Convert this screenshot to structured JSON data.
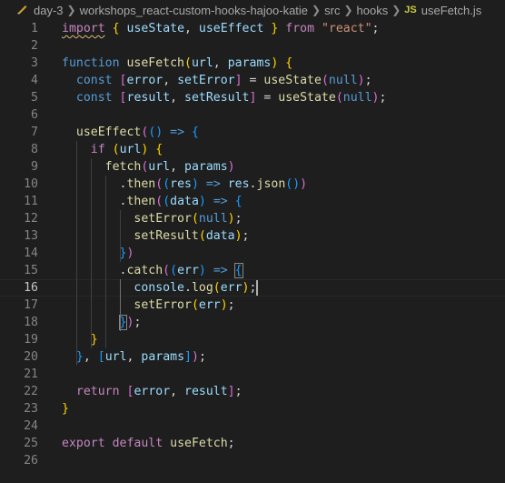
{
  "breadcrumb": {
    "items": [
      "day-3",
      "workshops_react-custom-hooks-hajoo-katie",
      "src",
      "hooks"
    ],
    "file_icon": "JS",
    "file": "useFetch.js"
  },
  "editor": {
    "lines": [
      {
        "n": "1",
        "t": [
          [
            "ctl squig",
            "import"
          ],
          [
            "pun",
            " "
          ],
          [
            "b1",
            "{"
          ],
          [
            "pun",
            " "
          ],
          [
            "var",
            "useState"
          ],
          [
            "pun",
            ", "
          ],
          [
            "var",
            "useEffect"
          ],
          [
            "pun",
            " "
          ],
          [
            "b1",
            "}"
          ],
          [
            "pun",
            " "
          ],
          [
            "ctl",
            "from"
          ],
          [
            "pun",
            " "
          ],
          [
            "str",
            "\"react\""
          ],
          [
            "pun",
            ";"
          ]
        ]
      },
      {
        "n": "2",
        "t": []
      },
      {
        "n": "3",
        "t": [
          [
            "kw",
            "function"
          ],
          [
            "pun",
            " "
          ],
          [
            "fn",
            "useFetch"
          ],
          [
            "b1",
            "("
          ],
          [
            "var",
            "url"
          ],
          [
            "pun",
            ", "
          ],
          [
            "var",
            "params"
          ],
          [
            "b1",
            ")"
          ],
          [
            "pun",
            " "
          ],
          [
            "b1",
            "{"
          ]
        ]
      },
      {
        "n": "4",
        "t": [
          [
            "pun",
            "  "
          ],
          [
            "kw",
            "const"
          ],
          [
            "pun",
            " "
          ],
          [
            "b2",
            "["
          ],
          [
            "var",
            "error"
          ],
          [
            "pun",
            ", "
          ],
          [
            "var",
            "setError"
          ],
          [
            "b2",
            "]"
          ],
          [
            "pun",
            " = "
          ],
          [
            "fn",
            "useState"
          ],
          [
            "b2",
            "("
          ],
          [
            "kw",
            "null"
          ],
          [
            "b2",
            ")"
          ],
          [
            "pun",
            ";"
          ]
        ]
      },
      {
        "n": "5",
        "t": [
          [
            "pun",
            "  "
          ],
          [
            "kw",
            "const"
          ],
          [
            "pun",
            " "
          ],
          [
            "b2",
            "["
          ],
          [
            "var",
            "result"
          ],
          [
            "pun",
            ", "
          ],
          [
            "var",
            "setResult"
          ],
          [
            "b2",
            "]"
          ],
          [
            "pun",
            " = "
          ],
          [
            "fn",
            "useState"
          ],
          [
            "b2",
            "("
          ],
          [
            "kw",
            "null"
          ],
          [
            "b2",
            ")"
          ],
          [
            "pun",
            ";"
          ]
        ]
      },
      {
        "n": "6",
        "t": []
      },
      {
        "n": "7",
        "t": [
          [
            "pun",
            "  "
          ],
          [
            "fn",
            "useEffect"
          ],
          [
            "b2",
            "("
          ],
          [
            "b3",
            "()"
          ],
          [
            "pun",
            " "
          ],
          [
            "kw",
            "=>"
          ],
          [
            "pun",
            " "
          ],
          [
            "b3",
            "{"
          ]
        ]
      },
      {
        "n": "8",
        "t": [
          [
            "pun",
            "    "
          ],
          [
            "ctl",
            "if"
          ],
          [
            "pun",
            " "
          ],
          [
            "b1",
            "("
          ],
          [
            "var",
            "url"
          ],
          [
            "b1",
            ")"
          ],
          [
            "pun",
            " "
          ],
          [
            "b1",
            "{"
          ]
        ]
      },
      {
        "n": "9",
        "t": [
          [
            "pun",
            "      "
          ],
          [
            "fn",
            "fetch"
          ],
          [
            "b2",
            "("
          ],
          [
            "var",
            "url"
          ],
          [
            "pun",
            ", "
          ],
          [
            "var",
            "params"
          ],
          [
            "b2",
            ")"
          ]
        ]
      },
      {
        "n": "10",
        "t": [
          [
            "pun",
            "        ."
          ],
          [
            "fn",
            "then"
          ],
          [
            "b2",
            "("
          ],
          [
            "b3",
            "("
          ],
          [
            "var",
            "res"
          ],
          [
            "b3",
            ")"
          ],
          [
            "pun",
            " "
          ],
          [
            "kw",
            "=>"
          ],
          [
            "pun",
            " "
          ],
          [
            "var",
            "res"
          ],
          [
            "pun",
            "."
          ],
          [
            "fn",
            "json"
          ],
          [
            "b3",
            "()"
          ],
          [
            "b2",
            ")"
          ]
        ]
      },
      {
        "n": "11",
        "t": [
          [
            "pun",
            "        ."
          ],
          [
            "fn",
            "then"
          ],
          [
            "b2",
            "("
          ],
          [
            "b3",
            "("
          ],
          [
            "var",
            "data"
          ],
          [
            "b3",
            ")"
          ],
          [
            "pun",
            " "
          ],
          [
            "kw",
            "=>"
          ],
          [
            "pun",
            " "
          ],
          [
            "b3",
            "{"
          ]
        ]
      },
      {
        "n": "12",
        "t": [
          [
            "pun",
            "          "
          ],
          [
            "fn",
            "setError"
          ],
          [
            "b1",
            "("
          ],
          [
            "kw",
            "null"
          ],
          [
            "b1",
            ")"
          ],
          [
            "pun",
            ";"
          ]
        ]
      },
      {
        "n": "13",
        "t": [
          [
            "pun",
            "          "
          ],
          [
            "fn",
            "setResult"
          ],
          [
            "b1",
            "("
          ],
          [
            "var",
            "data"
          ],
          [
            "b1",
            ")"
          ],
          [
            "pun",
            ";"
          ]
        ]
      },
      {
        "n": "14",
        "t": [
          [
            "pun",
            "        "
          ],
          [
            "b3",
            "}"
          ],
          [
            "b2",
            ")"
          ]
        ]
      },
      {
        "n": "15",
        "t": [
          [
            "pun",
            "        ."
          ],
          [
            "fn",
            "catch"
          ],
          [
            "b2",
            "("
          ],
          [
            "b3",
            "("
          ],
          [
            "var",
            "err"
          ],
          [
            "b3",
            ")"
          ],
          [
            "pun",
            " "
          ],
          [
            "kw",
            "=>"
          ],
          [
            "pun",
            " "
          ],
          [
            "b3 match",
            "{"
          ]
        ]
      },
      {
        "n": "16",
        "t": [
          [
            "pun",
            "          "
          ],
          [
            "var",
            "console"
          ],
          [
            "pun",
            "."
          ],
          [
            "fn",
            "log"
          ],
          [
            "b1",
            "("
          ],
          [
            "var",
            "err"
          ],
          [
            "b1",
            ")"
          ],
          [
            "pun",
            ";"
          ]
        ]
      },
      {
        "n": "17",
        "t": [
          [
            "pun",
            "          "
          ],
          [
            "fn",
            "setError"
          ],
          [
            "b1",
            "("
          ],
          [
            "var",
            "err"
          ],
          [
            "b1",
            ")"
          ],
          [
            "pun",
            ";"
          ]
        ]
      },
      {
        "n": "18",
        "t": [
          [
            "pun",
            "        "
          ],
          [
            "b3 match",
            "}"
          ],
          [
            "b2",
            ")"
          ],
          [
            "pun",
            ";"
          ]
        ]
      },
      {
        "n": "19",
        "t": [
          [
            "pun",
            "    "
          ],
          [
            "b1",
            "}"
          ]
        ]
      },
      {
        "n": "20",
        "t": [
          [
            "pun",
            "  "
          ],
          [
            "b3",
            "}"
          ],
          [
            "pun",
            ", "
          ],
          [
            "b3",
            "["
          ],
          [
            "var",
            "url"
          ],
          [
            "pun",
            ", "
          ],
          [
            "var",
            "params"
          ],
          [
            "b3",
            "]"
          ],
          [
            "b2",
            ")"
          ],
          [
            "pun",
            ";"
          ]
        ]
      },
      {
        "n": "21",
        "t": []
      },
      {
        "n": "22",
        "t": [
          [
            "pun",
            "  "
          ],
          [
            "ctl",
            "return"
          ],
          [
            "pun",
            " "
          ],
          [
            "b2",
            "["
          ],
          [
            "var",
            "error"
          ],
          [
            "pun",
            ", "
          ],
          [
            "var",
            "result"
          ],
          [
            "b2",
            "]"
          ],
          [
            "pun",
            ";"
          ]
        ]
      },
      {
        "n": "23",
        "t": [
          [
            "b1",
            "}"
          ]
        ]
      },
      {
        "n": "24",
        "t": []
      },
      {
        "n": "25",
        "t": [
          [
            "ctl",
            "export"
          ],
          [
            "pun",
            " "
          ],
          [
            "ctl",
            "default"
          ],
          [
            "pun",
            " "
          ],
          [
            "fn",
            "useFetch"
          ],
          [
            "pun",
            ";"
          ]
        ]
      },
      {
        "n": "26",
        "t": []
      }
    ],
    "active_line": "16"
  }
}
